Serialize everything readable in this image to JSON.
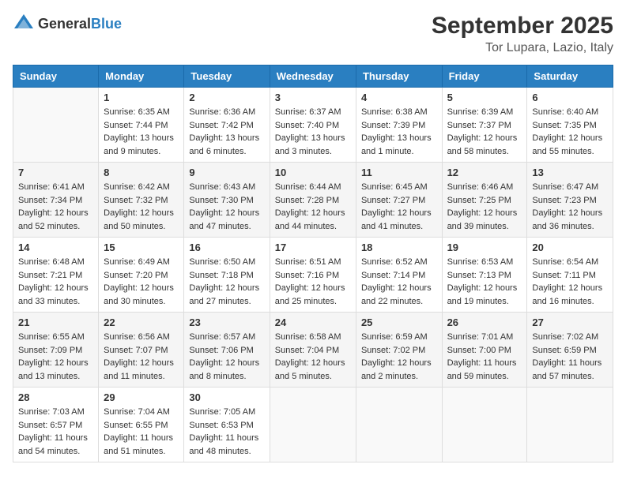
{
  "header": {
    "logo_general": "General",
    "logo_blue": "Blue",
    "month": "September 2025",
    "location": "Tor Lupara, Lazio, Italy"
  },
  "weekdays": [
    "Sunday",
    "Monday",
    "Tuesday",
    "Wednesday",
    "Thursday",
    "Friday",
    "Saturday"
  ],
  "weeks": [
    [
      {
        "day": "",
        "info": ""
      },
      {
        "day": "1",
        "info": "Sunrise: 6:35 AM\nSunset: 7:44 PM\nDaylight: 13 hours\nand 9 minutes."
      },
      {
        "day": "2",
        "info": "Sunrise: 6:36 AM\nSunset: 7:42 PM\nDaylight: 13 hours\nand 6 minutes."
      },
      {
        "day": "3",
        "info": "Sunrise: 6:37 AM\nSunset: 7:40 PM\nDaylight: 13 hours\nand 3 minutes."
      },
      {
        "day": "4",
        "info": "Sunrise: 6:38 AM\nSunset: 7:39 PM\nDaylight: 13 hours\nand 1 minute."
      },
      {
        "day": "5",
        "info": "Sunrise: 6:39 AM\nSunset: 7:37 PM\nDaylight: 12 hours\nand 58 minutes."
      },
      {
        "day": "6",
        "info": "Sunrise: 6:40 AM\nSunset: 7:35 PM\nDaylight: 12 hours\nand 55 minutes."
      }
    ],
    [
      {
        "day": "7",
        "info": "Sunrise: 6:41 AM\nSunset: 7:34 PM\nDaylight: 12 hours\nand 52 minutes."
      },
      {
        "day": "8",
        "info": "Sunrise: 6:42 AM\nSunset: 7:32 PM\nDaylight: 12 hours\nand 50 minutes."
      },
      {
        "day": "9",
        "info": "Sunrise: 6:43 AM\nSunset: 7:30 PM\nDaylight: 12 hours\nand 47 minutes."
      },
      {
        "day": "10",
        "info": "Sunrise: 6:44 AM\nSunset: 7:28 PM\nDaylight: 12 hours\nand 44 minutes."
      },
      {
        "day": "11",
        "info": "Sunrise: 6:45 AM\nSunset: 7:27 PM\nDaylight: 12 hours\nand 41 minutes."
      },
      {
        "day": "12",
        "info": "Sunrise: 6:46 AM\nSunset: 7:25 PM\nDaylight: 12 hours\nand 39 minutes."
      },
      {
        "day": "13",
        "info": "Sunrise: 6:47 AM\nSunset: 7:23 PM\nDaylight: 12 hours\nand 36 minutes."
      }
    ],
    [
      {
        "day": "14",
        "info": "Sunrise: 6:48 AM\nSunset: 7:21 PM\nDaylight: 12 hours\nand 33 minutes."
      },
      {
        "day": "15",
        "info": "Sunrise: 6:49 AM\nSunset: 7:20 PM\nDaylight: 12 hours\nand 30 minutes."
      },
      {
        "day": "16",
        "info": "Sunrise: 6:50 AM\nSunset: 7:18 PM\nDaylight: 12 hours\nand 27 minutes."
      },
      {
        "day": "17",
        "info": "Sunrise: 6:51 AM\nSunset: 7:16 PM\nDaylight: 12 hours\nand 25 minutes."
      },
      {
        "day": "18",
        "info": "Sunrise: 6:52 AM\nSunset: 7:14 PM\nDaylight: 12 hours\nand 22 minutes."
      },
      {
        "day": "19",
        "info": "Sunrise: 6:53 AM\nSunset: 7:13 PM\nDaylight: 12 hours\nand 19 minutes."
      },
      {
        "day": "20",
        "info": "Sunrise: 6:54 AM\nSunset: 7:11 PM\nDaylight: 12 hours\nand 16 minutes."
      }
    ],
    [
      {
        "day": "21",
        "info": "Sunrise: 6:55 AM\nSunset: 7:09 PM\nDaylight: 12 hours\nand 13 minutes."
      },
      {
        "day": "22",
        "info": "Sunrise: 6:56 AM\nSunset: 7:07 PM\nDaylight: 12 hours\nand 11 minutes."
      },
      {
        "day": "23",
        "info": "Sunrise: 6:57 AM\nSunset: 7:06 PM\nDaylight: 12 hours\nand 8 minutes."
      },
      {
        "day": "24",
        "info": "Sunrise: 6:58 AM\nSunset: 7:04 PM\nDaylight: 12 hours\nand 5 minutes."
      },
      {
        "day": "25",
        "info": "Sunrise: 6:59 AM\nSunset: 7:02 PM\nDaylight: 12 hours\nand 2 minutes."
      },
      {
        "day": "26",
        "info": "Sunrise: 7:01 AM\nSunset: 7:00 PM\nDaylight: 11 hours\nand 59 minutes."
      },
      {
        "day": "27",
        "info": "Sunrise: 7:02 AM\nSunset: 6:59 PM\nDaylight: 11 hours\nand 57 minutes."
      }
    ],
    [
      {
        "day": "28",
        "info": "Sunrise: 7:03 AM\nSunset: 6:57 PM\nDaylight: 11 hours\nand 54 minutes."
      },
      {
        "day": "29",
        "info": "Sunrise: 7:04 AM\nSunset: 6:55 PM\nDaylight: 11 hours\nand 51 minutes."
      },
      {
        "day": "30",
        "info": "Sunrise: 7:05 AM\nSunset: 6:53 PM\nDaylight: 11 hours\nand 48 minutes."
      },
      {
        "day": "",
        "info": ""
      },
      {
        "day": "",
        "info": ""
      },
      {
        "day": "",
        "info": ""
      },
      {
        "day": "",
        "info": ""
      }
    ]
  ]
}
